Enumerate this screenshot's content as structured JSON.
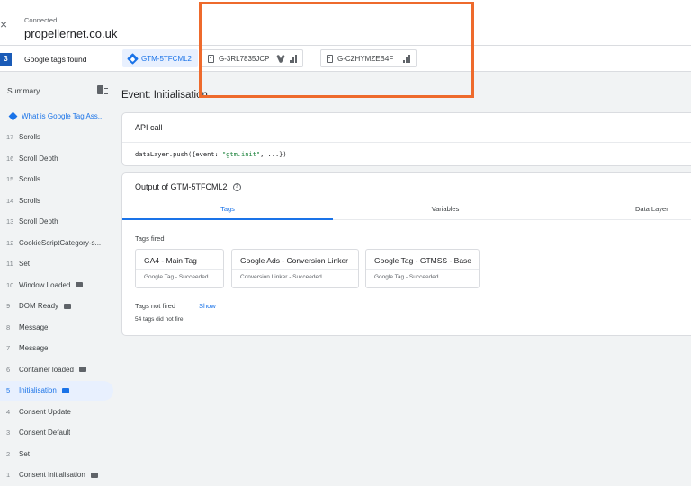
{
  "header": {
    "close_label": "×",
    "status": "Connected",
    "domain": "propellernet.co.uk"
  },
  "tagbar": {
    "count": "3",
    "label": "Google tags found",
    "chips": [
      {
        "id": "GTM-5TFCML2",
        "active": true,
        "icons": [
          "gtm-icon"
        ]
      },
      {
        "id": "G-3RL7835JCP",
        "active": false,
        "icons": [
          "tag-icon",
          "google-ads-icon",
          "signal-icon"
        ]
      },
      {
        "id": "G-CZHYMZEB4F",
        "active": false,
        "icons": [
          "tag-icon",
          "signal-icon"
        ]
      }
    ]
  },
  "sidebar": {
    "summary_label": "Summary",
    "events": [
      {
        "num": "",
        "label": "What is Google Tag Ass...",
        "icon": "gtm-icon",
        "badge": false
      },
      {
        "num": "17",
        "label": "Scrolls",
        "badge": false
      },
      {
        "num": "16",
        "label": "Scroll Depth",
        "badge": false
      },
      {
        "num": "15",
        "label": "Scrolls",
        "badge": false
      },
      {
        "num": "14",
        "label": "Scrolls",
        "badge": false
      },
      {
        "num": "13",
        "label": "Scroll Depth",
        "badge": false
      },
      {
        "num": "12",
        "label": "CookieScriptCategory-s...",
        "badge": false
      },
      {
        "num": "11",
        "label": "Set",
        "badge": false
      },
      {
        "num": "10",
        "label": "Window Loaded",
        "badge": true
      },
      {
        "num": "9",
        "label": "DOM Ready",
        "badge": true
      },
      {
        "num": "8",
        "label": "Message",
        "badge": false
      },
      {
        "num": "7",
        "label": "Message",
        "badge": false
      },
      {
        "num": "6",
        "label": "Container loaded",
        "badge": true
      },
      {
        "num": "5",
        "label": "Initialisation",
        "badge": true,
        "selected": true
      },
      {
        "num": "4",
        "label": "Consent Update",
        "badge": false
      },
      {
        "num": "3",
        "label": "Consent Default",
        "badge": false
      },
      {
        "num": "2",
        "label": "Set",
        "badge": false
      },
      {
        "num": "1",
        "label": "Consent Initialisation",
        "badge": true
      }
    ]
  },
  "main": {
    "event_title": "Event: Initialisation",
    "api_card": {
      "title": "API call",
      "code_prefix": "dataLayer.push({event: ",
      "code_string": "\"gtm.init\"",
      "code_suffix": ", ...})"
    },
    "output_card": {
      "title": "Output of GTM-5TFCML2",
      "tabs": [
        "Tags",
        "Variables",
        "Data Layer"
      ],
      "active_tab": 0,
      "tags_fired_label": "Tags fired",
      "tags_fired": [
        {
          "name": "GA4 - Main Tag",
          "status": "Google Tag - Succeeded"
        },
        {
          "name": "Google Ads - Conversion Linker",
          "status": "Conversion Linker - Succeeded"
        },
        {
          "name": "Google Tag - GTMSS - Base",
          "status": "Google Tag - Succeeded"
        }
      ],
      "tags_not_fired_label": "Tags not fired",
      "show_label": "Show",
      "not_fired_summary": "54 tags did not fire"
    }
  },
  "colors": {
    "accent": "#1a73e8",
    "badge_blue": "#1a5bb7",
    "highlight": "#ee6a2c"
  }
}
